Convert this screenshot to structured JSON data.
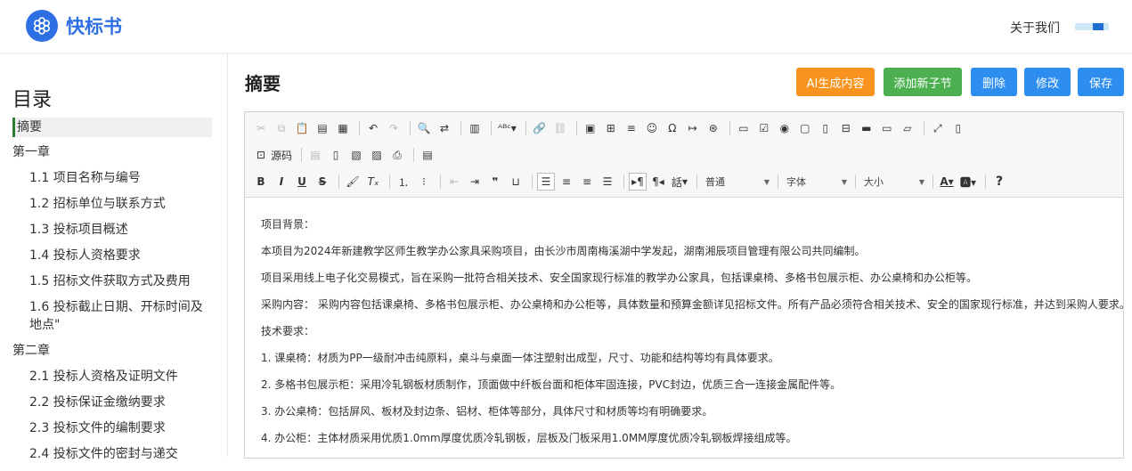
{
  "header": {
    "brand": "快标书",
    "about": "关于我们"
  },
  "sidebar": {
    "title": "目录",
    "items": [
      {
        "label": "摘要",
        "kind": "active"
      },
      {
        "label": "第一章",
        "kind": "chapter"
      },
      {
        "label": "1.1 项目名称与编号",
        "kind": "sub"
      },
      {
        "label": "1.2 招标单位与联系方式",
        "kind": "sub"
      },
      {
        "label": "1.3 投标项目概述",
        "kind": "sub"
      },
      {
        "label": "1.4 投标人资格要求",
        "kind": "sub"
      },
      {
        "label": "1.5 招标文件获取方式及费用",
        "kind": "sub"
      },
      {
        "label": "1.6 投标截止日期、开标时间及地点\"",
        "kind": "sub"
      },
      {
        "label": "第二章",
        "kind": "chapter"
      },
      {
        "label": "2.1 投标人资格及证明文件",
        "kind": "sub"
      },
      {
        "label": "2.2 投标保证金缴纳要求",
        "kind": "sub"
      },
      {
        "label": "2.3 投标文件的编制要求",
        "kind": "sub"
      },
      {
        "label": "2.4 投标文件的密封与递交",
        "kind": "sub"
      }
    ]
  },
  "main": {
    "title": "摘要",
    "buttons": {
      "ai": "AI生成内容",
      "add": "添加新子节",
      "delete": "删除",
      "edit": "修改",
      "save": "保存"
    }
  },
  "toolbar": {
    "source_label": "源码",
    "format_select": "普通",
    "font_select": "字体",
    "size_select": "大小",
    "list_style": "話"
  },
  "content": [
    "项目背景：",
    "本项目为2024年新建教学区师生教学办公家具采购项目，由长沙市周南梅溪湖中学发起，湖南湘辰项目管理有限公司共同编制。",
    "项目采用线上电子化交易模式，旨在采购一批符合相关技术、安全国家现行标准的教学办公家具，包括课桌椅、多格书包展示柜、办公桌椅和办公柜等。",
    "采购内容：  采购内容包括课桌椅、多格书包展示柜、办公桌椅和办公柜等，具体数量和预算金额详见招标文件。所有产品必须符合相关技术、安全的国家现行标准，并达到采购人要求。",
    "技术要求：",
    "1. 课桌椅：材质为PP一级耐冲击纯原料，桌斗与桌面一体注塑射出成型，尺寸、功能和结构等均有具体要求。",
    "2. 多格书包展示柜：采用冷轧钢板材质制作，顶面做中纤板台面和柜体牢固连接，PVC封边，优质三合一连接金属配件等。",
    "3. 办公桌椅：包括屏风、板材及封边条、铝材、柜体等部分，具体尺寸和材质等均有明确要求。",
    "4. 办公柜：主体材质采用优质1.0mm厚度优质冷轧钢板，层板及门板采用1.0MM厚度优质冷轧钢板焊接组成等。"
  ]
}
